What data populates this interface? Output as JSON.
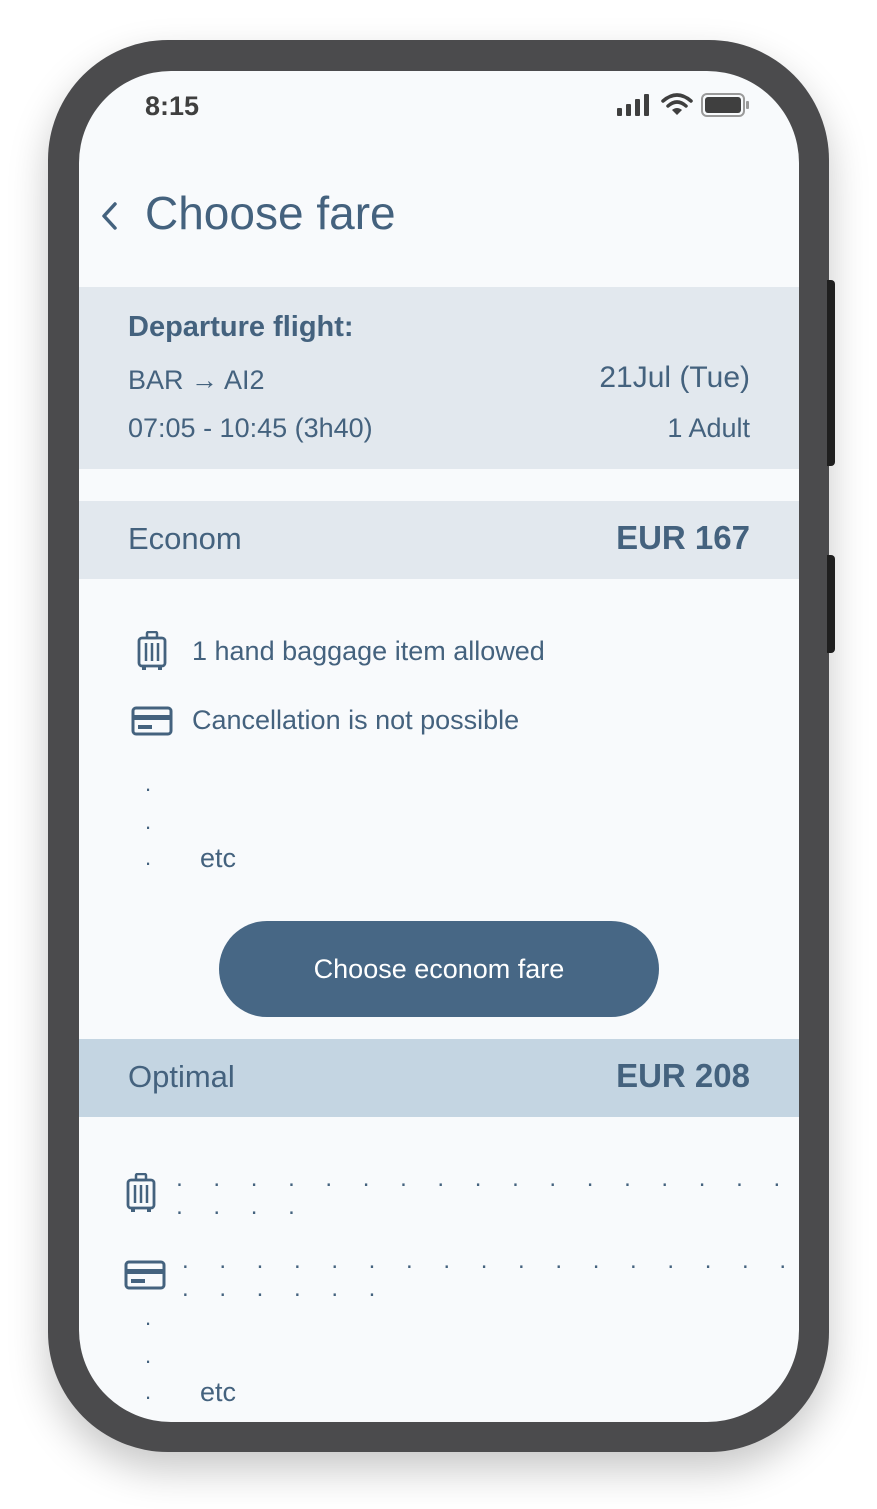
{
  "status_bar": {
    "time": "8:15",
    "icons": [
      "signal-icon",
      "wifi-icon",
      "battery-icon"
    ]
  },
  "header": {
    "back_icon": "chevron-left-icon",
    "title": "Choose fare"
  },
  "flight": {
    "heading": "Departure flight:",
    "route": "BAR → AI2",
    "date": "21Jul (Tue)",
    "times": "07:05 - 10:45 (3h40)",
    "passengers": "1 Adult"
  },
  "fares": [
    {
      "name": "Econom",
      "price": "EUR 167",
      "features": [
        {
          "icon": "luggage-icon",
          "text": "1 hand baggage item allowed"
        },
        {
          "icon": "credit-card-icon",
          "text": "Cancellation is not possible"
        }
      ],
      "more_dots": [
        ".",
        ".",
        "."
      ],
      "etc": "etc",
      "button_label": "Choose econom fare"
    },
    {
      "name": "Optimal",
      "price": "EUR 208",
      "features": [
        {
          "icon": "luggage-icon",
          "text": ". . . . . . . . . . . . . . . . . . . . ."
        },
        {
          "icon": "credit-card-icon",
          "text": ". . . . . . . . . . . . . . . . . . . . . . ."
        }
      ],
      "more_dots": [
        ".",
        ".",
        "."
      ],
      "etc": "etc"
    }
  ],
  "colors": {
    "primary": "#476785",
    "text": "#44627e",
    "summary_bg": "#e2e8ee",
    "optimal_bg": "#c4d5e2",
    "screen_bg": "#f8fafc"
  }
}
